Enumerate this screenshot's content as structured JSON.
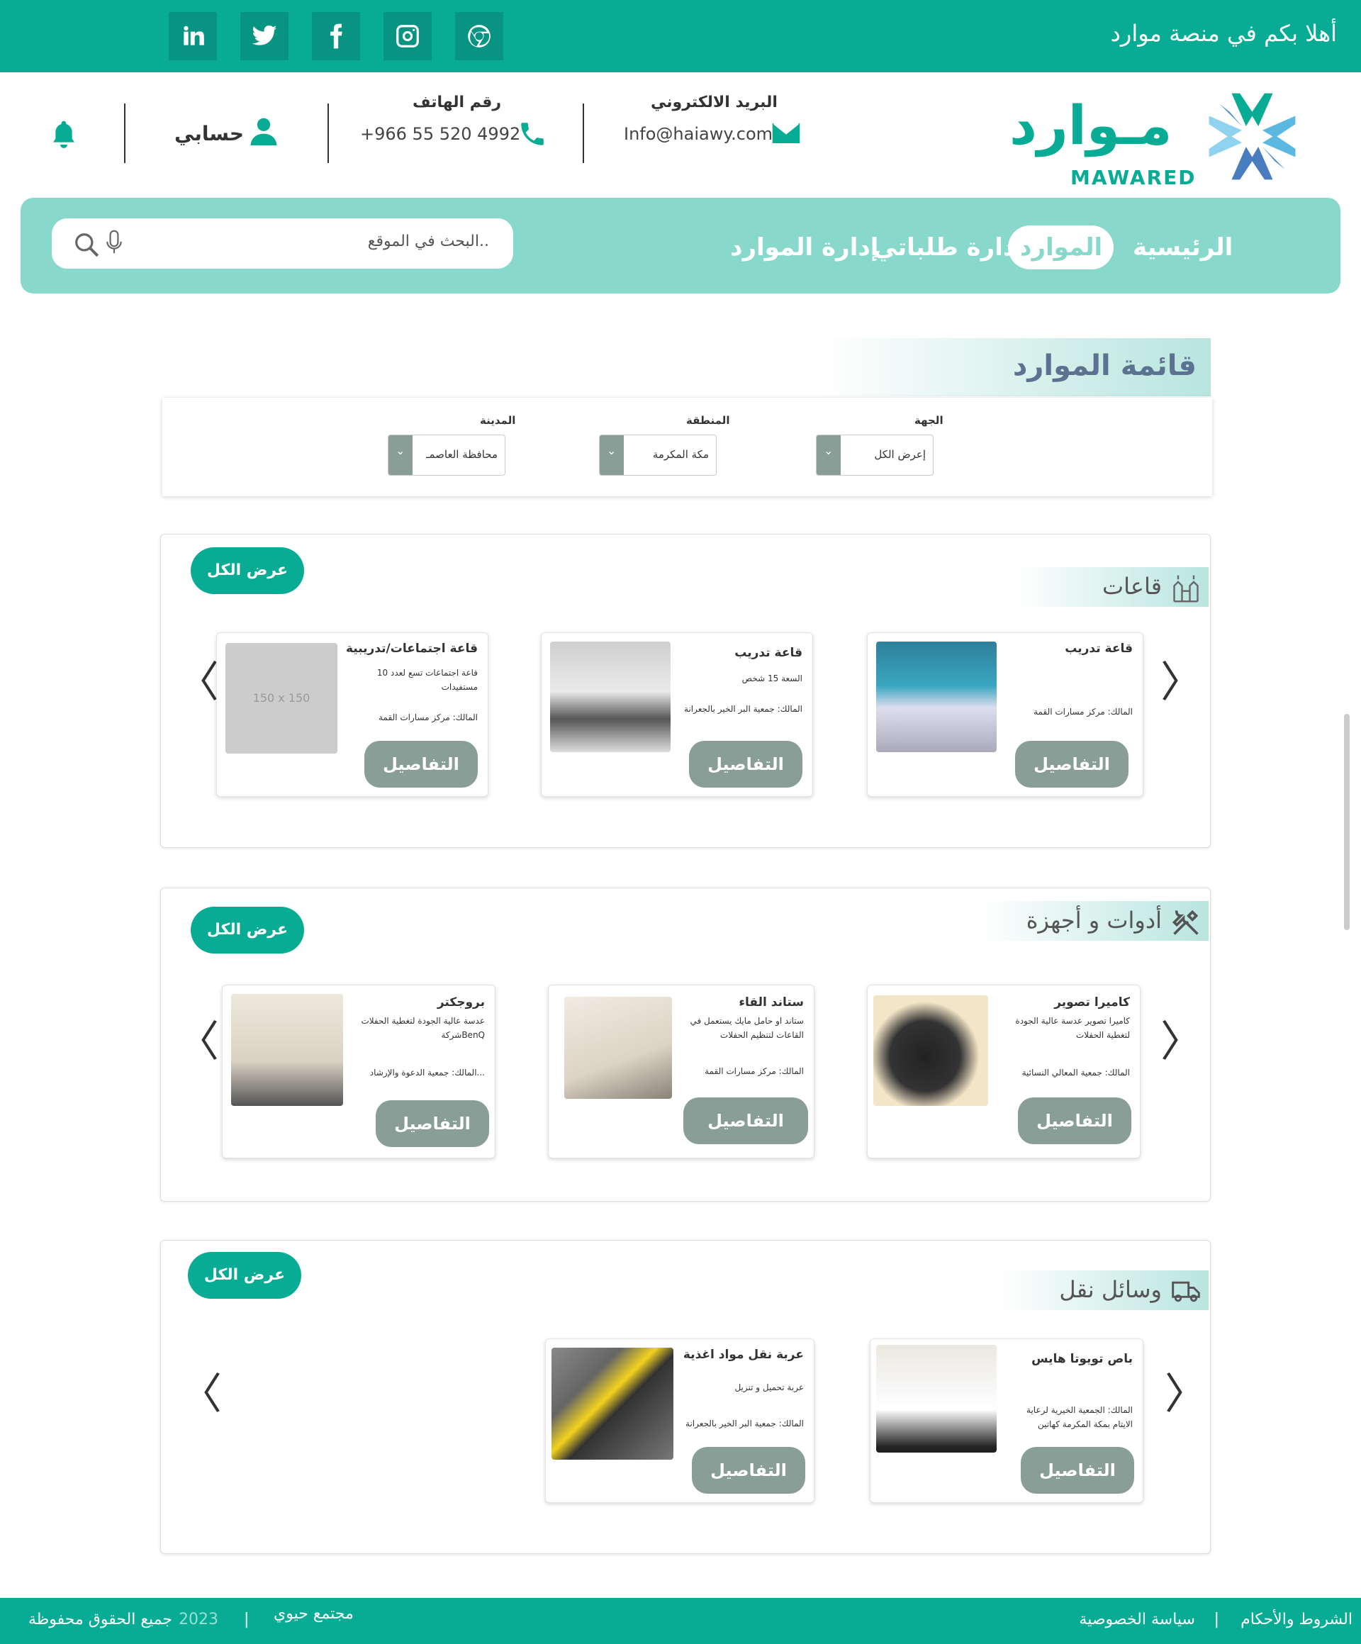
{
  "topbar": {
    "welcome": "أهلا بكم في منصة موارد",
    "social": [
      "linkedin-icon",
      "twitter-icon",
      "facebook-icon",
      "instagram-icon",
      "chrome-icon"
    ]
  },
  "header": {
    "logo_ar": "مـوارد",
    "logo_en": "MAWARED",
    "email_label": "البريد الالكتروني",
    "email_value": "Info@haiawy.com",
    "phone_label": "رقم الهاتف",
    "phone_value": "+966 55 520 4992",
    "account_label": "حسابي"
  },
  "nav": {
    "items": [
      "الرئيسية",
      "الموارد",
      "إدارة طلباتي",
      "إدارة الموارد"
    ],
    "active": "الموارد",
    "search_placeholder": "البحث في الموقع.."
  },
  "list_title": "قائمة الموارد",
  "filters": {
    "entity_label": "الجهة",
    "entity_value": "إعرض الكل",
    "region_label": "المنطقة",
    "region_value": "مكة المكرمة",
    "city_label": "المدينة",
    "city_value": "محافظة العاصمـ"
  },
  "sections": [
    {
      "title": "قاعات",
      "view_all": "عرض الكل",
      "cards": [
        {
          "title": "قاعة تدريب",
          "desc": "",
          "owner": "المالك: مركز مسارات القمة",
          "details": "التفاصيل"
        },
        {
          "title": "قاعة تدريب",
          "desc": "السعة 15 شخص",
          "owner": "المالك: جمعية البر الخير بالجعرانة",
          "details": "التفاصيل"
        },
        {
          "title": "قاعة اجتماعات/تدريبية",
          "desc": "قاعة اجتماعات تسع لعدد 10 مستفيدات",
          "owner": "المالك: مركز مسارات القمة",
          "details": "التفاصيل",
          "placeholder": "150 x 150"
        }
      ]
    },
    {
      "title": "أدوات و أجهزة",
      "view_all": "عرض الكل",
      "cards": [
        {
          "title": "كاميرا تصوير",
          "desc": "كاميرا تصوير عدسة عالية الجودة لتغطية الحفلات",
          "owner": "المالك: جمعية المعالي النسائية",
          "details": "التفاصيل"
        },
        {
          "title": "ستاند القاء",
          "desc": "ستاند او حامل مايك يستعمل في القاعات لتنظيم الحفلات",
          "owner": "المالك: مركز مسارات القمة",
          "details": "التفاصيل"
        },
        {
          "title": "بروجكتر",
          "desc": "عدسة عالية الجودة لتغطية الحفلات شركةBenQ",
          "owner": "المالك: جمعية الدعوة والإرشاد...",
          "details": "التفاصيل"
        }
      ]
    },
    {
      "title": "وسائل نقل",
      "view_all": "عرض الكل",
      "cards": [
        {
          "title": "باص تويوتا هايس",
          "desc": "",
          "owner": "المالك: الجمعية الخيرية لرعاية الايتام بمكة المكرمة كهاتين",
          "details": "التفاصيل"
        },
        {
          "title": "عربة نقل مواد اغذية",
          "desc": "عربة تحميل و تنزيل",
          "owner": "المالك: جمعية البر الخير بالجعرانة",
          "details": "التفاصيل"
        }
      ]
    }
  ],
  "footer": {
    "terms": "الشروط والأحكام",
    "privacy": "سياسة الخصوصية",
    "community": "مجتمع حيوي",
    "year": "2023",
    "rights": "جميع الحقوق محفوظة"
  },
  "colors": {
    "primary": "#08ac95",
    "nav": "#88d8cb",
    "button": "#889e97"
  }
}
